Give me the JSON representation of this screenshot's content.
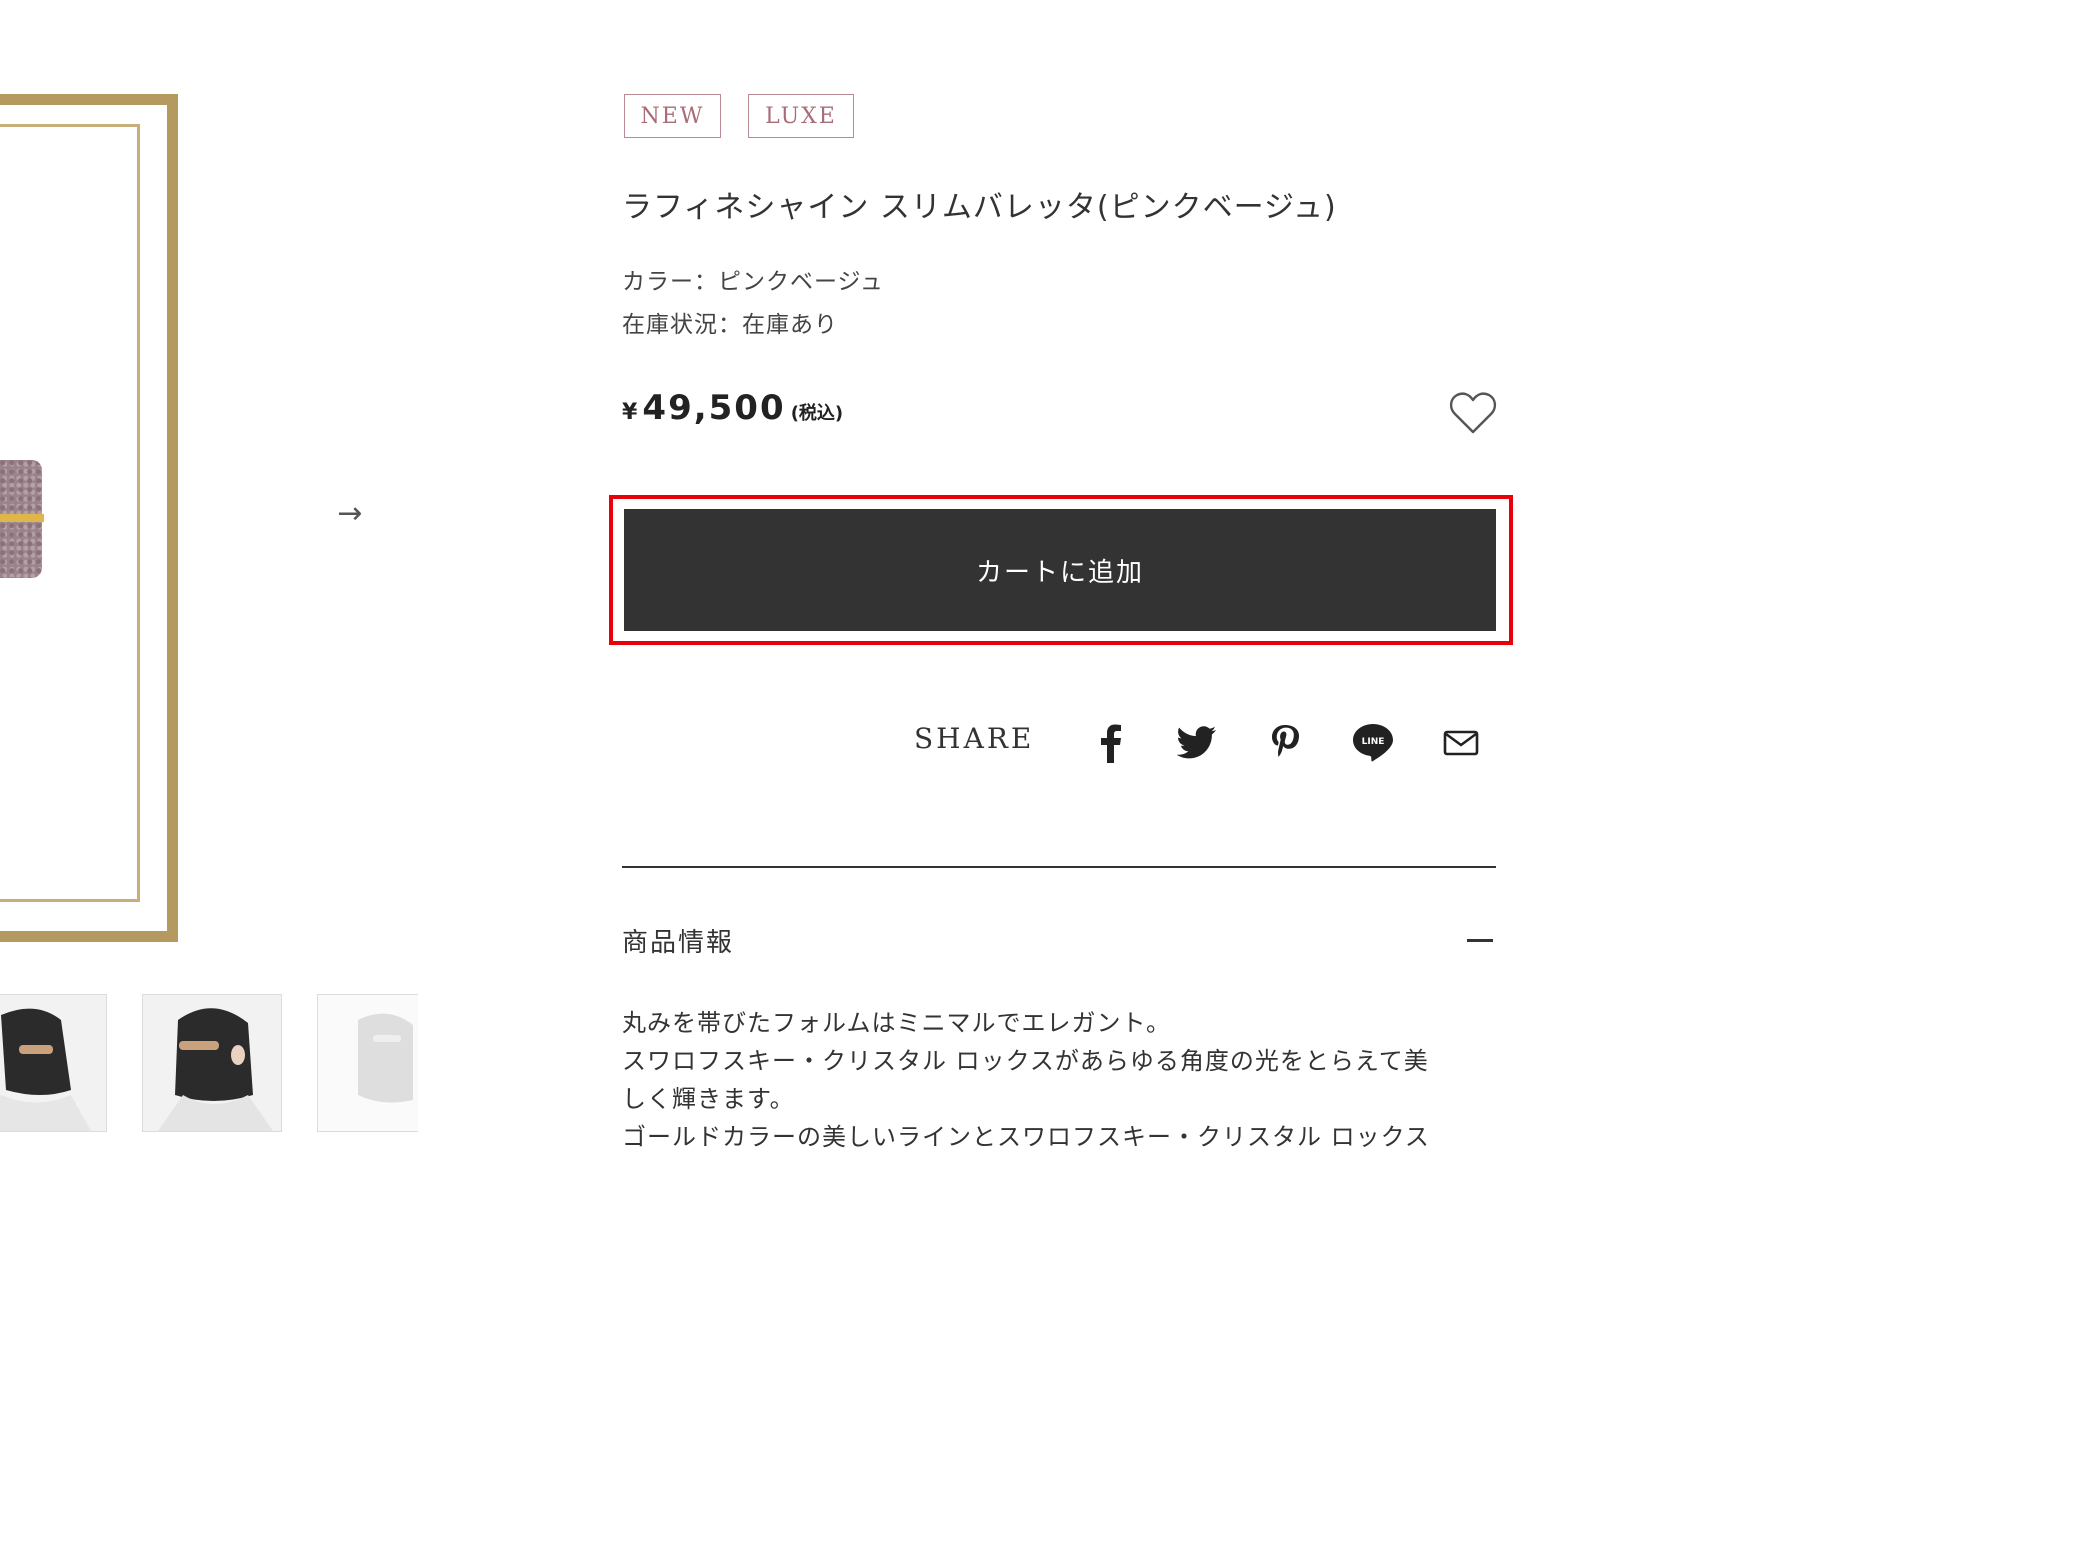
{
  "gallery": {
    "next_arrow": "→",
    "thumbnails": [
      {
        "name": "thumbnail-1"
      },
      {
        "name": "thumbnail-2"
      },
      {
        "name": "thumbnail-3"
      }
    ]
  },
  "product": {
    "tags": [
      "NEW",
      "LUXE"
    ],
    "title": "ラフィネシャイン スリムバレッタ(ピンクベージュ)",
    "color_line": "カラー：ピンクベージュ",
    "stock_line": "在庫状況：在庫あり",
    "price": {
      "currency": "¥",
      "amount": "49,500",
      "tax_note": "(税込)"
    },
    "favorite_icon": "heart-outline-icon",
    "add_to_cart_label": "カートに追加"
  },
  "share": {
    "label": "SHARE",
    "icons": [
      "facebook-icon",
      "twitter-icon",
      "pinterest-icon",
      "line-icon",
      "mail-icon"
    ]
  },
  "info_section": {
    "title": "商品情報",
    "toggle_icon": "minus-icon",
    "description": [
      "丸みを帯びたフォルムはミニマルでエレガント。",
      "スワロフスキー・クリスタル ロックスがあらゆる角度の光をとらえて美",
      "しく輝きます。",
      "ゴールドカラーの美しいラインとスワロフスキー・クリスタル ロックス"
    ]
  },
  "colors": {
    "frame_gold": "#b49a61",
    "tag_border": "#b98a91",
    "button_bg": "#333333",
    "highlight_red": "#e8000b"
  }
}
